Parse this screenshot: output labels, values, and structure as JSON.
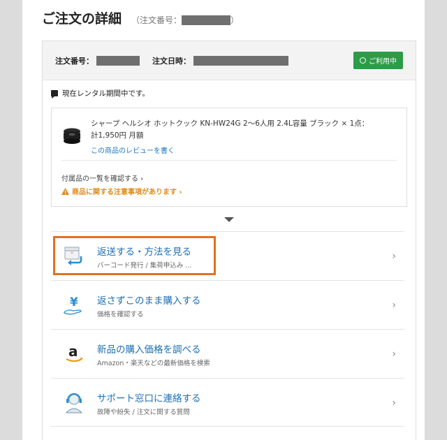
{
  "page": {
    "title": "ご注文の詳細",
    "order_number_prefix": "（注文番号：",
    "order_number_suffix": "）"
  },
  "card": {
    "order_number_label": "注文番号：",
    "order_date_label": "注文日時：",
    "status_badge": "ご利用中"
  },
  "notice": {
    "text": "現在レンタル期間中です。"
  },
  "product": {
    "name_line1": "シャープ ヘルシオ ホットクック KN-HW24G 2～6人用 2.4L容量 ブラック × 1点：",
    "name_line2": "計1,950円 月額",
    "review_link": "この商品のレビューを書く",
    "accessories_link": "付属品の一覧を確認する ›",
    "warning_link": "商品に関する注意事項があります ›"
  },
  "menu": {
    "items": [
      {
        "title": "返送する・方法を見る",
        "desc": "バーコード発行 / 集荷申込み ...",
        "icon": "return-box-icon"
      },
      {
        "title": "返さずこのまま購入する",
        "desc": "価格を確認する",
        "icon": "yen-hand-icon"
      },
      {
        "title": "新品の購入価格を調べる",
        "desc": "Amazon・楽天などの最新価格を検索",
        "icon": "amazon-icon"
      },
      {
        "title": "サポート窓口に連絡する",
        "desc": "故障や紛失 / 注文に関する質問",
        "icon": "support-headset-icon"
      }
    ],
    "chevron": "›"
  },
  "colors": {
    "accent_blue": "#1d6fb5",
    "status_green": "#2e9b48",
    "warning_orange": "#e08a18",
    "highlight_orange": "#e86e1c"
  }
}
